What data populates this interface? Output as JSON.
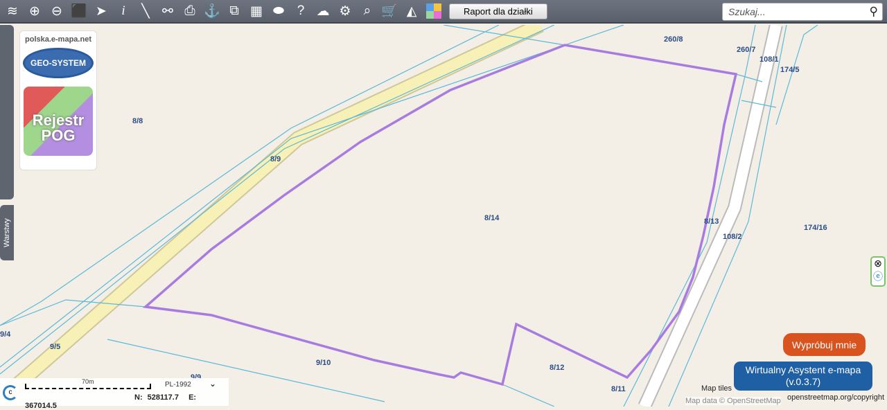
{
  "toolbar": {
    "icons": [
      "layers-icon",
      "zoom-in-icon",
      "zoom-out-icon",
      "full-extent-icon",
      "pointer-icon",
      "info-icon",
      "measure-icon",
      "link-icon",
      "print-icon",
      "download-icon",
      "compare-icon",
      "layout-icon",
      "shape-icon",
      "help-icon",
      "cloud-upload-icon",
      "settings-icon",
      "search-map-icon",
      "cart-icon",
      "terrain-icon",
      "colors-icon"
    ],
    "report_label": "Raport dla działki"
  },
  "search": {
    "placeholder": "Szukaj..."
  },
  "logos": {
    "site": "polska.e-mapa.net",
    "geo": "GEO-SYSTEM",
    "pog_line1": "Rejestr",
    "pog_line2": "POG"
  },
  "layers_tab": "Warstwy",
  "parcels": [
    "260/8",
    "260/7",
    "108/1",
    "174/5",
    "8/8",
    "8/9",
    "8/14",
    "8/13",
    "174/16",
    "108/2",
    "9/4",
    "9/5",
    "9/10",
    "8/12",
    "9/9",
    "8/11"
  ],
  "status": {
    "scale": "70m",
    "crs": "PL-1992",
    "n": "N: 528117.7",
    "e": "E: 367014.5"
  },
  "assistant": {
    "try": "Wypróbuj mnie",
    "title": "Wirtualny Asystent e-mapa",
    "version": "(v.0.3.7)"
  },
  "attribution": {
    "tiles": "Map tiles",
    "data": "Map data © OpenStreetMap",
    "link": "openstreetmap.org/copyright"
  },
  "colors": {
    "parcel": "#a77be0",
    "boundary": "#5cb8d8",
    "road": "#f7f1b8"
  }
}
